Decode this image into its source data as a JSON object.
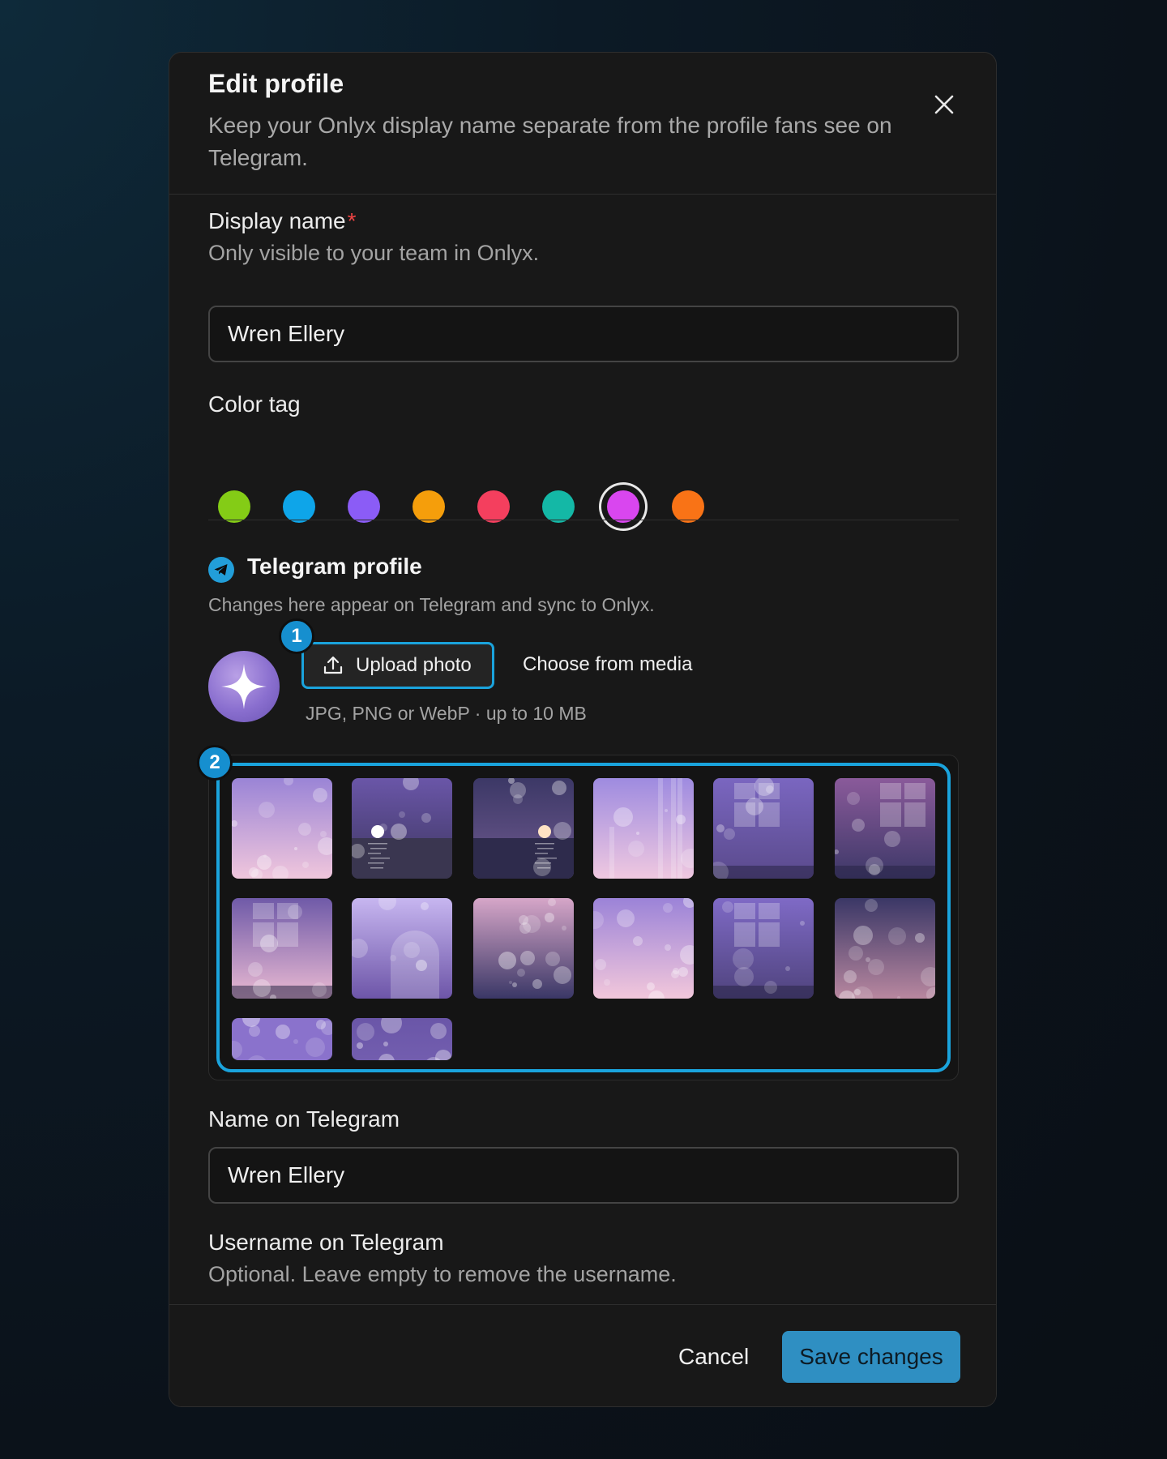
{
  "dialog": {
    "title": "Edit profile",
    "subtitle": "Keep your Onlyx display name separate from the profile fans see on Telegram.",
    "close_icon": "close-icon"
  },
  "display_name": {
    "label": "Display name",
    "required_mark": "*",
    "hint": "Only visible to your team in Onlyx.",
    "value": "Wren Ellery"
  },
  "color_tag": {
    "label": "Color tag",
    "options": [
      "#84cc16",
      "#0ea5e9",
      "#8b5cf6",
      "#f59e0b",
      "#f43f5e",
      "#14b8a6",
      "#d946ef",
      "#f97316"
    ],
    "selected_index": 6
  },
  "telegram": {
    "title": "Telegram profile",
    "icon": "telegram-icon",
    "subtitle": "Changes here appear on Telegram and sync to Onlyx.",
    "avatar_icon": "sparkle-icon",
    "upload_label": "Upload photo",
    "upload_icon": "upload-icon",
    "choose_label": "Choose from media",
    "file_hint": "JPG, PNG or WebP · up to 10 MB",
    "badge_1": "1",
    "badge_2": "2",
    "media_tiles": [
      "bokeh-pink",
      "moon-sea",
      "sunset-sea",
      "light-beams",
      "window-violet",
      "window-pink",
      "window-pink-2",
      "archway",
      "bokeh-night",
      "bokeh-pink-2",
      "window-violet-2",
      "bokeh-dusk",
      "bokeh-violet-partial",
      "bokeh-violet-partial-2"
    ]
  },
  "name_on_telegram": {
    "label": "Name on Telegram",
    "value": "Wren Ellery"
  },
  "username_on_telegram": {
    "label": "Username on Telegram",
    "hint": "Optional. Leave empty to remove the username."
  },
  "footer": {
    "cancel_label": "Cancel",
    "save_label": "Save changes"
  }
}
